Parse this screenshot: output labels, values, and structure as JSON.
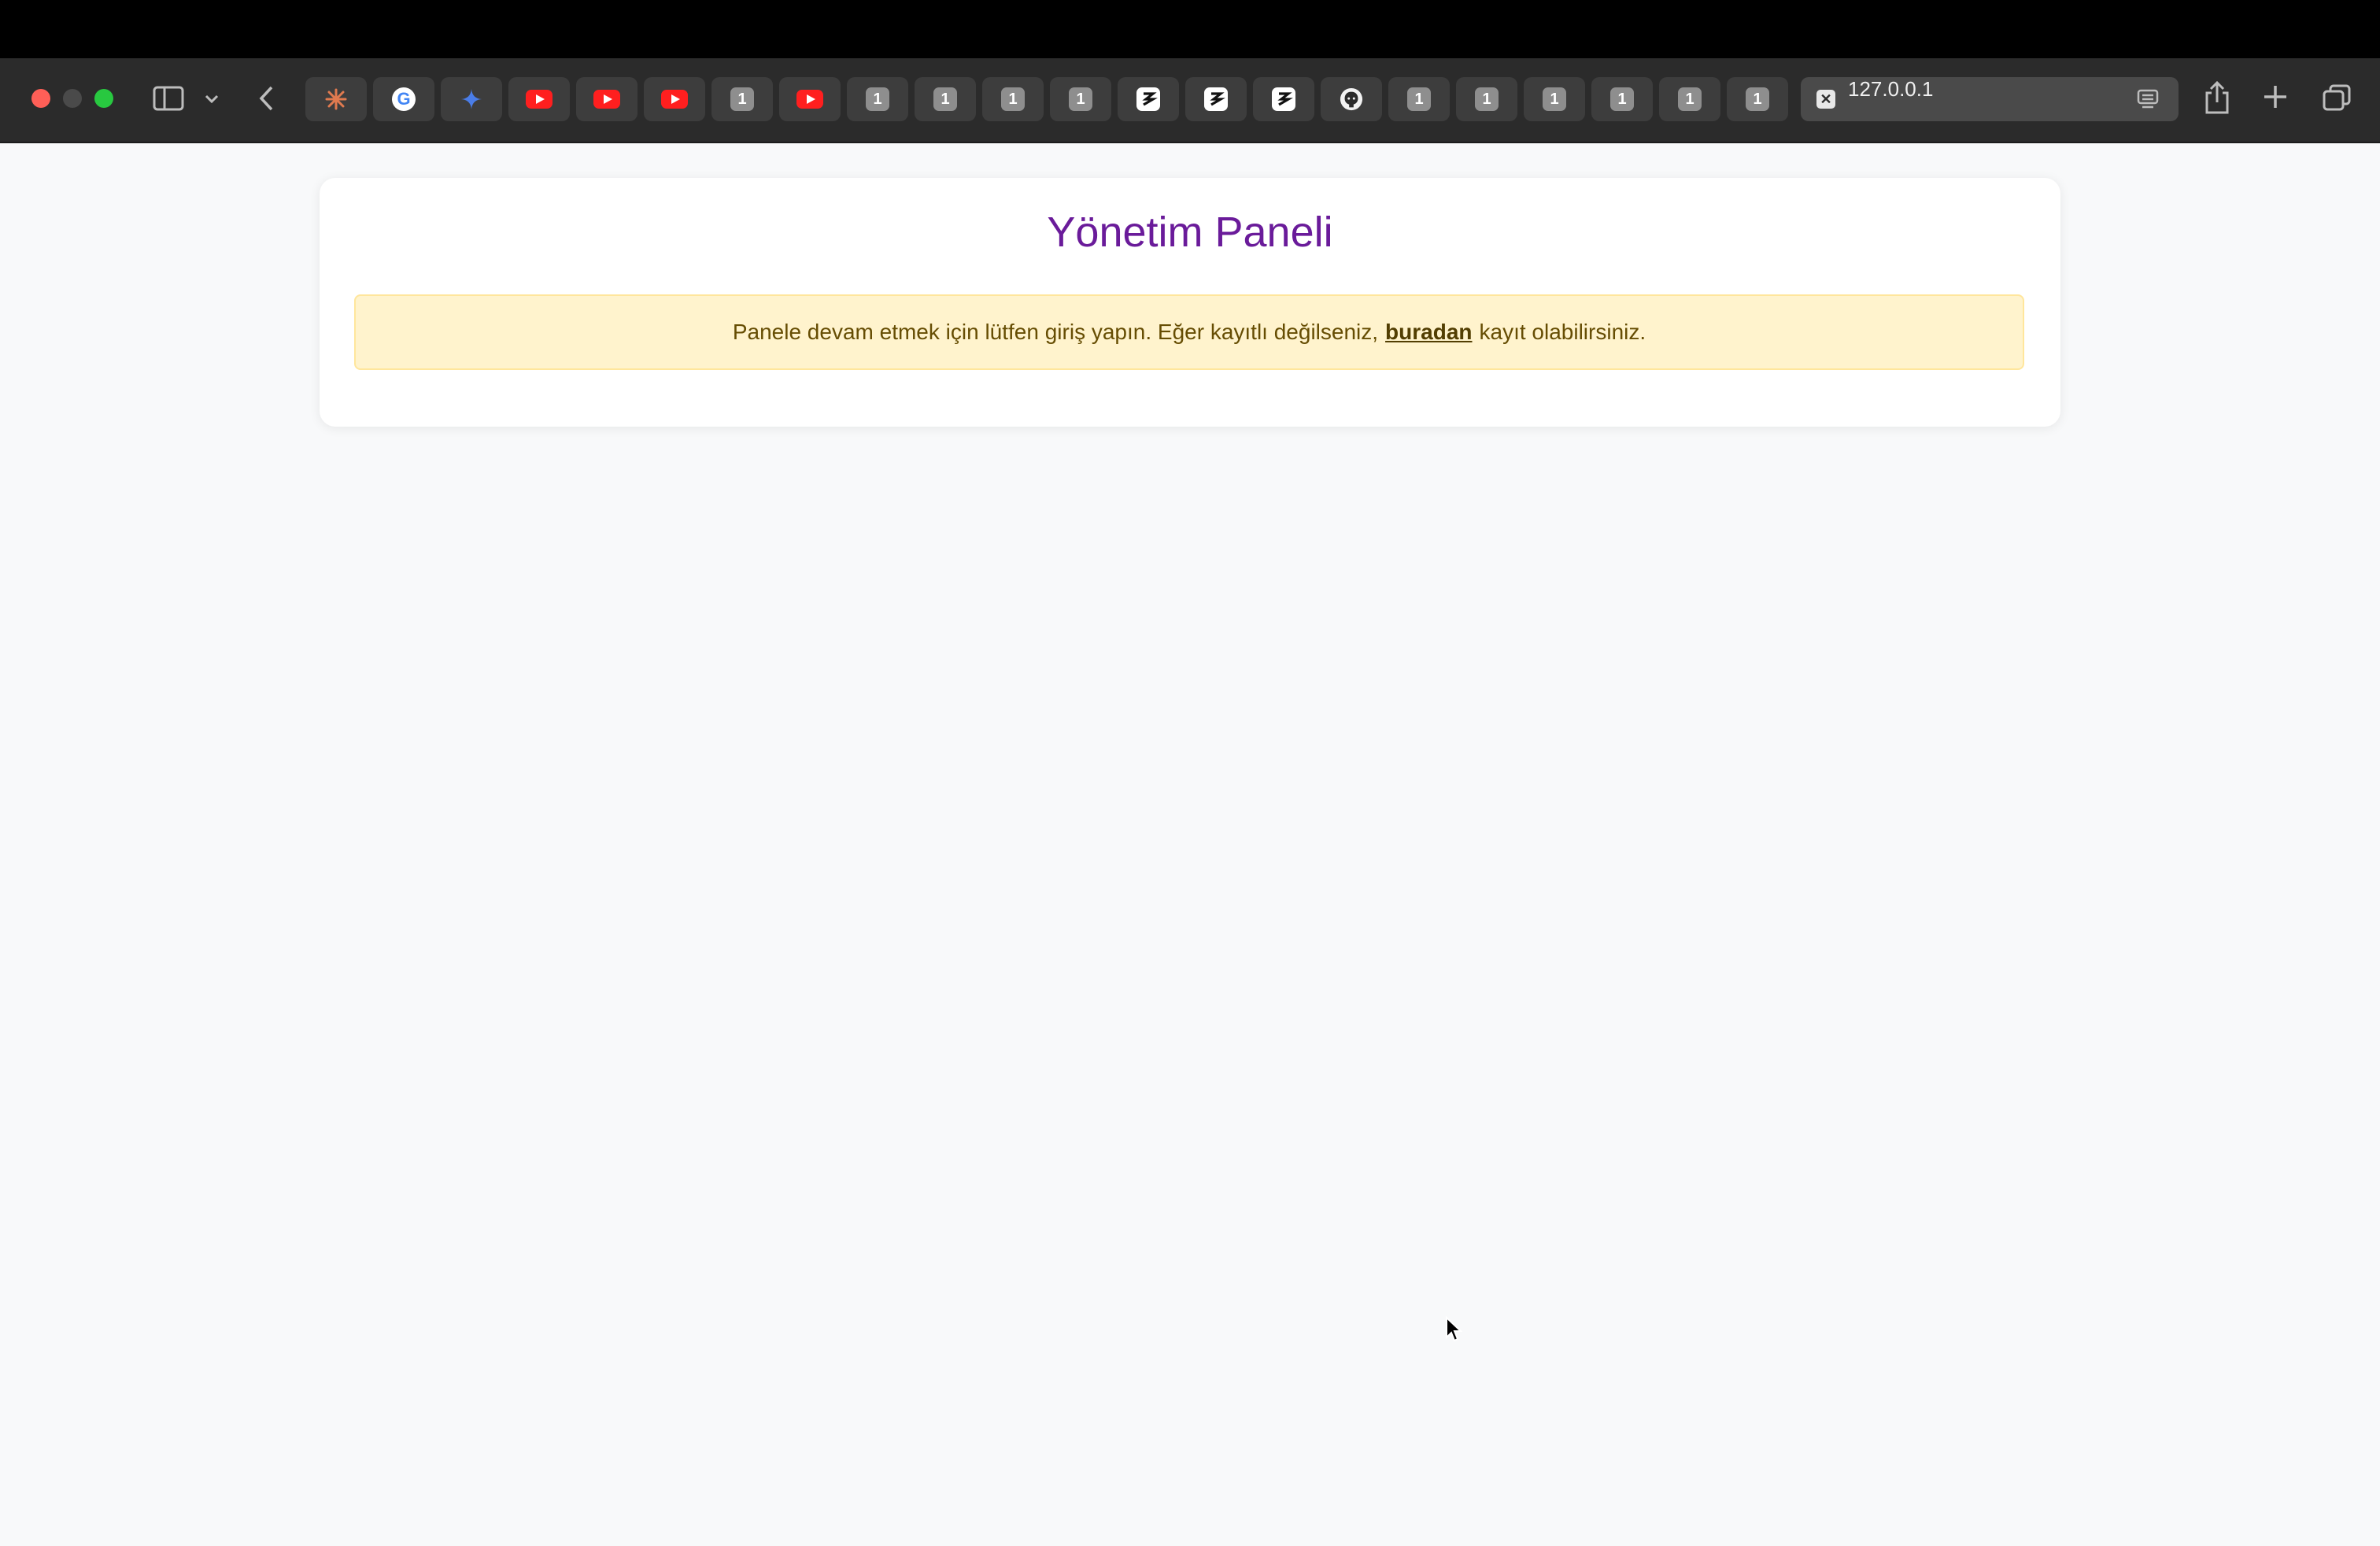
{
  "browser": {
    "address": "127.0.0.1",
    "tabs": [
      {
        "kind": "spark",
        "icon": "claude-spark-icon"
      },
      {
        "kind": "google",
        "icon": "google-icon",
        "glyph": "G"
      },
      {
        "kind": "gemini",
        "icon": "gemini-sparkle-icon"
      },
      {
        "kind": "youtube",
        "icon": "youtube-icon"
      },
      {
        "kind": "youtube",
        "icon": "youtube-icon"
      },
      {
        "kind": "youtube",
        "icon": "youtube-icon"
      },
      {
        "kind": "num",
        "icon": "numbered-site-icon",
        "glyph": "1"
      },
      {
        "kind": "youtube",
        "icon": "youtube-icon"
      },
      {
        "kind": "num",
        "icon": "numbered-site-icon",
        "glyph": "1"
      },
      {
        "kind": "num",
        "icon": "numbered-site-icon",
        "glyph": "1"
      },
      {
        "kind": "num",
        "icon": "numbered-site-icon",
        "glyph": "1"
      },
      {
        "kind": "num",
        "icon": "numbered-site-icon",
        "glyph": "1"
      },
      {
        "kind": "app",
        "icon": "app-logo-icon"
      },
      {
        "kind": "app",
        "icon": "app-logo-icon"
      },
      {
        "kind": "app",
        "icon": "app-logo-icon"
      },
      {
        "kind": "github",
        "icon": "github-icon"
      },
      {
        "kind": "num",
        "icon": "numbered-site-icon",
        "glyph": "1"
      },
      {
        "kind": "num",
        "icon": "numbered-site-icon",
        "glyph": "1"
      },
      {
        "kind": "num",
        "icon": "numbered-site-icon",
        "glyph": "1"
      },
      {
        "kind": "num",
        "icon": "numbered-site-icon",
        "glyph": "1"
      },
      {
        "kind": "num",
        "icon": "numbered-site-icon",
        "glyph": "1"
      },
      {
        "kind": "num",
        "icon": "numbered-site-icon",
        "glyph": "1"
      }
    ],
    "active_tab_close_glyph": "✕"
  },
  "page": {
    "title": "Yönetim Paneli",
    "alert": {
      "before_link": "Panele devam etmek için lütfen giriş yapın. Eğer kayıtlı değilseniz,",
      "link_text": "buradan",
      "after_link": "kayıt olabilirsiniz."
    }
  },
  "colors": {
    "title": "#6a1b9a",
    "alert_bg": "#fff3cd",
    "alert_border": "#ffe69c",
    "alert_text": "#664d03",
    "page_bg": "#f8f9fa"
  }
}
